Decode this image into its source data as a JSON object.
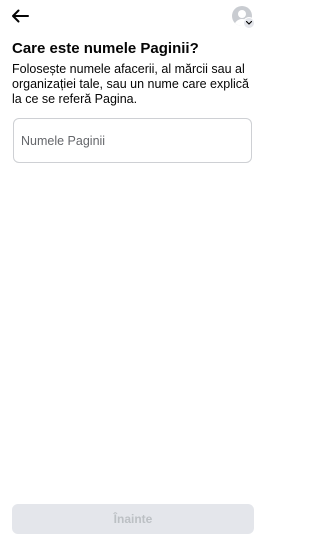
{
  "header": {
    "back_icon": "arrow-left-icon",
    "avatar_icon": "default-profile-avatar",
    "avatar_badge_icon": "chevron-down-icon"
  },
  "main": {
    "title": "Care este numele Paginii?",
    "description": "Folosește numele afacerii, al mărcii sau al organizației tale, sau un nume care explică la ce se referă Pagina.",
    "page_name_input": {
      "value": "",
      "placeholder": "Numele Paginii"
    }
  },
  "footer": {
    "next_label": "Înainte",
    "next_enabled": false
  },
  "colors": {
    "text_primary": "#050505",
    "text_secondary": "#65676b",
    "button_disabled_bg": "#e4e6eb",
    "button_disabled_text": "#bcc0c4",
    "input_border": "#ced0d4"
  }
}
